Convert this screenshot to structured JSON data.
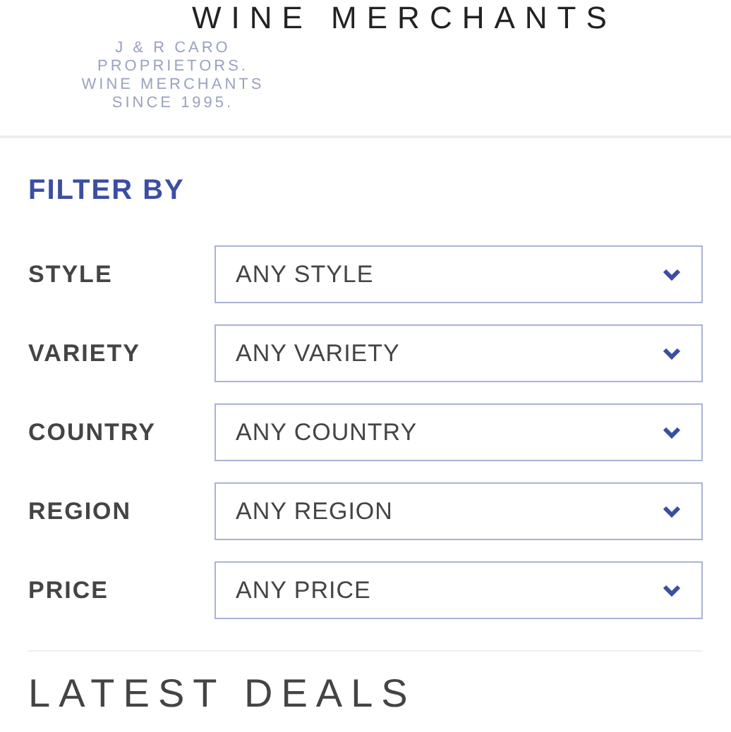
{
  "header": {
    "title": "WINE MERCHANTS",
    "faint_lines": [
      "J & R CARO",
      "PROPRIETORS.",
      "WINE MERCHANTS",
      "SINCE 1995."
    ]
  },
  "filter": {
    "heading": "FILTER BY",
    "fields": [
      {
        "label": "STYLE",
        "value": "ANY STYLE"
      },
      {
        "label": "VARIETY",
        "value": "ANY VARIETY"
      },
      {
        "label": "COUNTRY",
        "value": "ANY COUNTRY"
      },
      {
        "label": "REGION",
        "value": "ANY REGION"
      },
      {
        "label": "PRICE",
        "value": "ANY PRICE"
      }
    ]
  },
  "latest": {
    "heading": "LATEST DEALS"
  }
}
